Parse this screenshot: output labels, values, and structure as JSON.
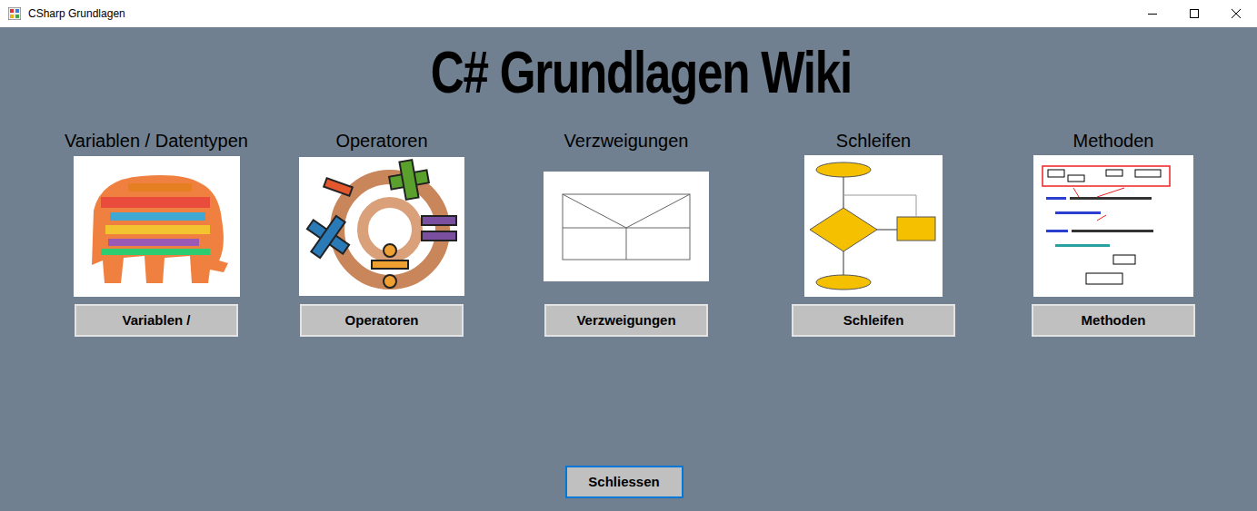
{
  "window": {
    "title": "CSharp Grundlagen"
  },
  "title": "C# Grundlagen Wiki",
  "sections": [
    {
      "heading": "Variablen / Datentypen",
      "button": "Variablen /"
    },
    {
      "heading": "Operatoren",
      "button": "Operatoren"
    },
    {
      "heading": "Verzweigungen",
      "button": "Verzweigungen"
    },
    {
      "heading": "Schleifen",
      "button": "Schleifen"
    },
    {
      "heading": "Methoden",
      "button": "Methoden"
    }
  ],
  "close_button": {
    "label": "Schliessen",
    "focused": true
  }
}
